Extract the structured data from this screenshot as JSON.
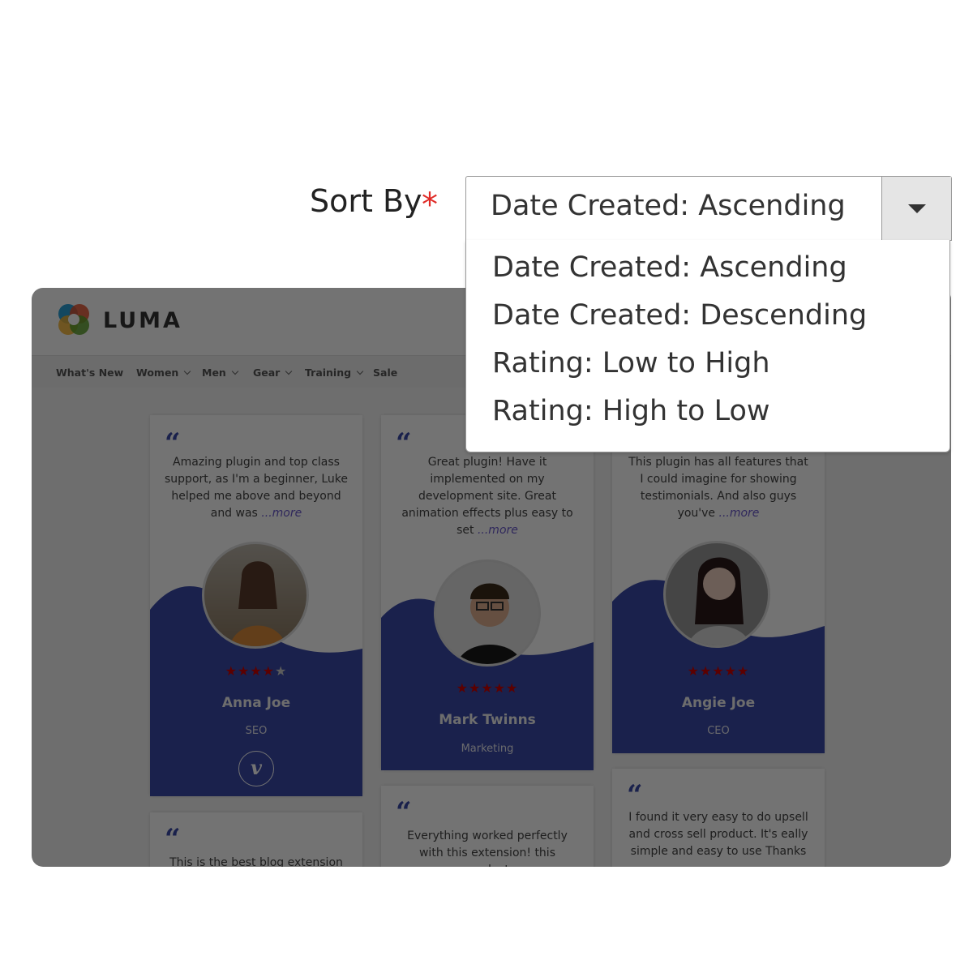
{
  "sort": {
    "label": "Sort By",
    "required_mark": "*",
    "selected": "Date Created: Ascending",
    "options": [
      "Date Created: Ascending",
      "Date Created: Descending",
      "Rating: Low to High",
      "Rating: High to Low"
    ]
  },
  "preview": {
    "brand": "LUMA",
    "nav": [
      "What's New",
      "Women",
      "Men",
      "Gear",
      "Training",
      "Sale"
    ],
    "more_label": "...more",
    "cards": [
      {
        "text": "Amazing plugin and top class support, as I'm a beginner, Luke helped me above and beyond and was",
        "stars": 4,
        "name": "Anna Joe",
        "role": "SEO",
        "social": "v"
      },
      {
        "text": "Great plugin! Have it implemented on my development site. Great animation effects plus easy to set",
        "stars": 5,
        "name": "Mark Twinns",
        "role": "Marketing"
      },
      {
        "text": "This plugin has all features that I could imagine for showing testimonials. And also guys you've",
        "stars": 5,
        "name": "Angie Joe",
        "role": "CEO"
      }
    ],
    "lower_cards": [
      "This is the best blog extension",
      "Everything worked perfectly with this extension! this product",
      "I found it very easy to do upsell and cross sell product. It's eally simple and easy to use Thanks"
    ],
    "colors": {
      "wave": "#3a4aa8",
      "quote": "#3a4aa8",
      "star_on": "#cc0000",
      "required": "#e02b27"
    }
  }
}
